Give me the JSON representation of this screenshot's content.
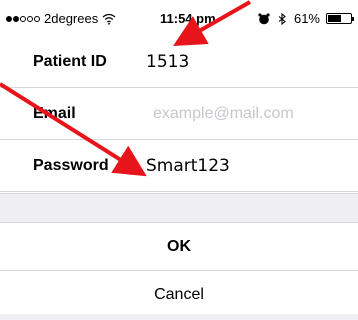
{
  "status_bar": {
    "signal_dots_filled": 2,
    "signal_dots_total": 5,
    "carrier": "2degrees",
    "wifi_icon": "wifi-icon",
    "time": "11:54 pm",
    "alarm_icon": "alarm-clock-icon",
    "bluetooth_icon": "bluetooth-icon",
    "battery_percent_label": "61%",
    "battery_level": 0.61
  },
  "form": {
    "fields": [
      {
        "label": "Patient ID",
        "value": "1513",
        "placeholder": ""
      },
      {
        "label": "Email",
        "value": "",
        "placeholder": "example@mail.com"
      },
      {
        "label": "Password",
        "value": "Smart123",
        "placeholder": ""
      }
    ]
  },
  "buttons": {
    "ok_label": "OK",
    "cancel_label": "Cancel"
  },
  "annotations": {
    "arrow_color": "#e8141c"
  }
}
